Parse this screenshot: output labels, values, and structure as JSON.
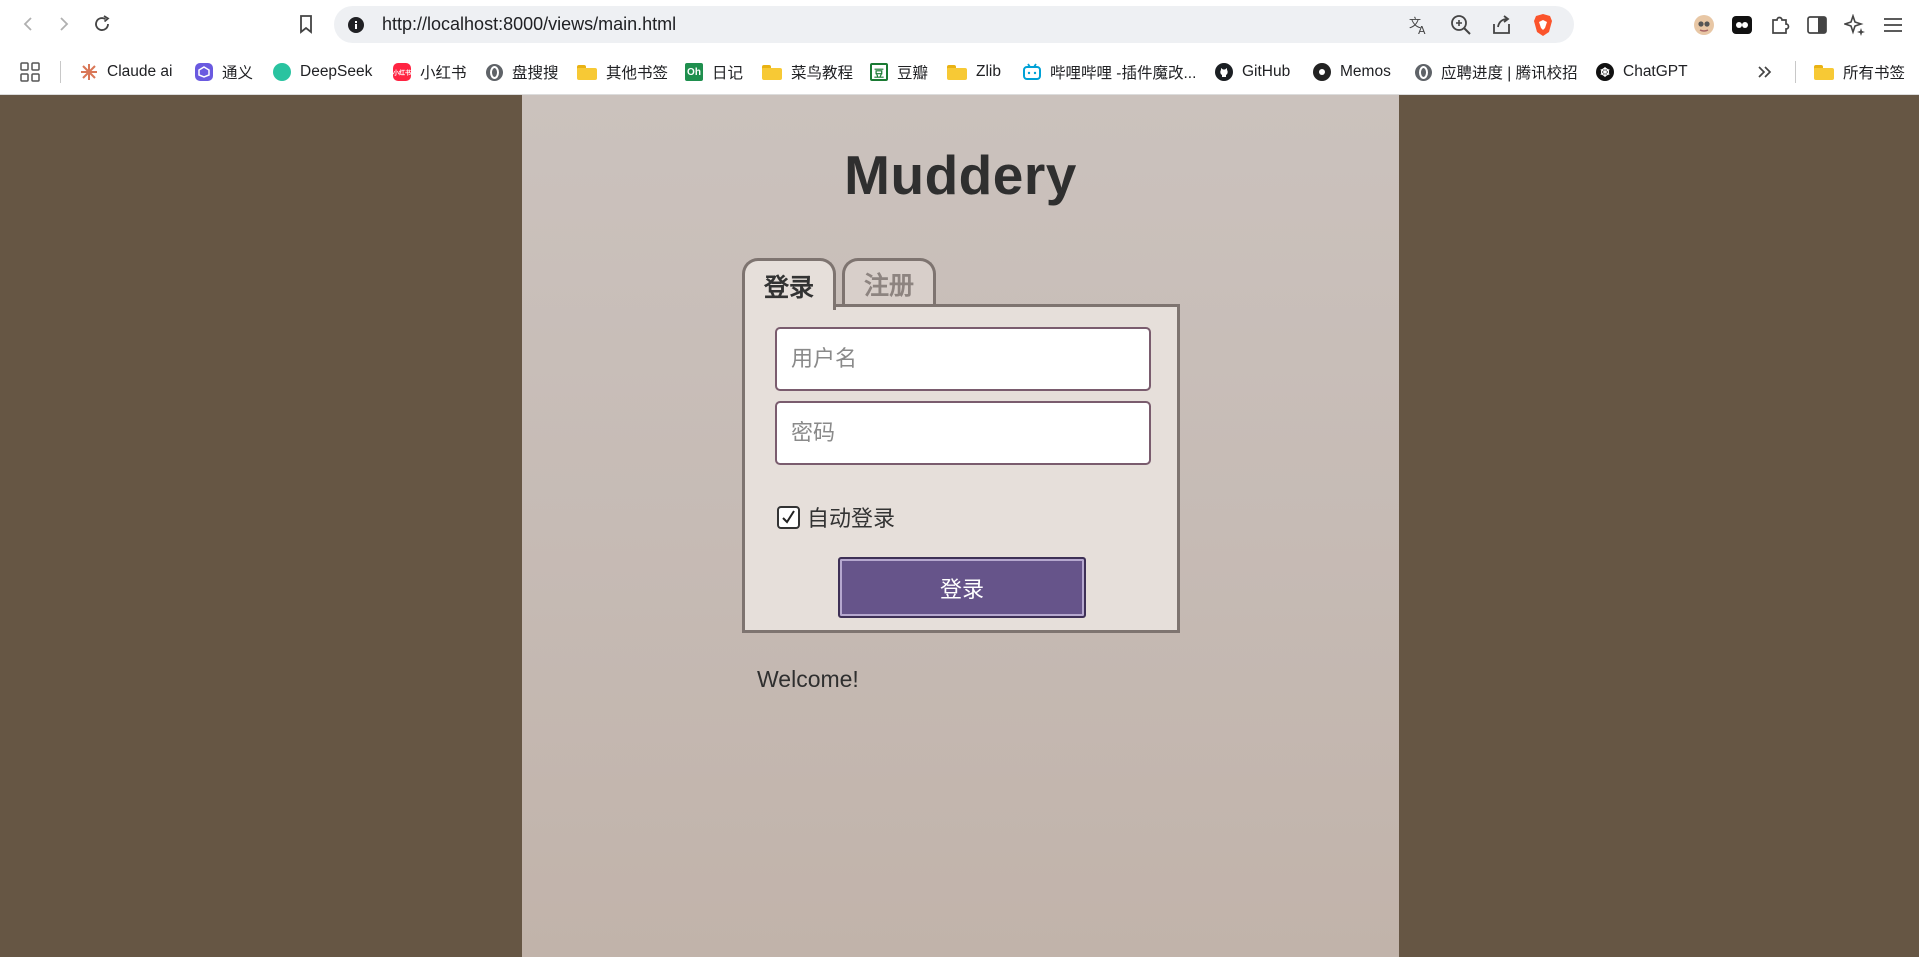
{
  "browser": {
    "url": "http://localhost:8000/views/main.html",
    "bookmarks": [
      {
        "label": "Claude ai",
        "icon": "claude-icon"
      },
      {
        "label": "通义",
        "icon": "tongyi-icon"
      },
      {
        "label": "DeepSeek",
        "icon": "deepseek-icon"
      },
      {
        "label": "小红书",
        "icon": "xiaohongshu-icon"
      },
      {
        "label": "盘搜搜",
        "icon": "globe-icon"
      },
      {
        "label": "其他书签",
        "icon": "folder-icon"
      },
      {
        "label": "日记",
        "icon": "oh-icon"
      },
      {
        "label": "菜鸟教程",
        "icon": "folder-icon"
      },
      {
        "label": "豆瓣",
        "icon": "douban-icon"
      },
      {
        "label": "Zlib",
        "icon": "folder-icon"
      },
      {
        "label": "哔哩哔哩 -插件魔改...",
        "icon": "bilibili-icon"
      },
      {
        "label": "GitHub",
        "icon": "github-icon"
      },
      {
        "label": "Memos",
        "icon": "memos-icon"
      },
      {
        "label": "应聘进度 | 腾讯校招",
        "icon": "globe-icon"
      },
      {
        "label": "ChatGPT",
        "icon": "chatgpt-icon"
      }
    ],
    "all_bookmarks": "所有书签",
    "oh_icon_text": "Oh",
    "xhs_icon_text": "小红书",
    "douban_icon_text": "豆"
  },
  "page": {
    "title": "Muddery",
    "tabs": {
      "login": "登录",
      "register": "注册"
    },
    "form": {
      "username_placeholder": "用户名",
      "password_placeholder": "密码",
      "auto_login_label": "自动登录",
      "auto_login_checked": true,
      "submit_label": "登录"
    },
    "welcome": "Welcome!"
  },
  "colors": {
    "outer_background": "#665644",
    "panel_background": "#e6dfda",
    "button": "#66548a"
  }
}
